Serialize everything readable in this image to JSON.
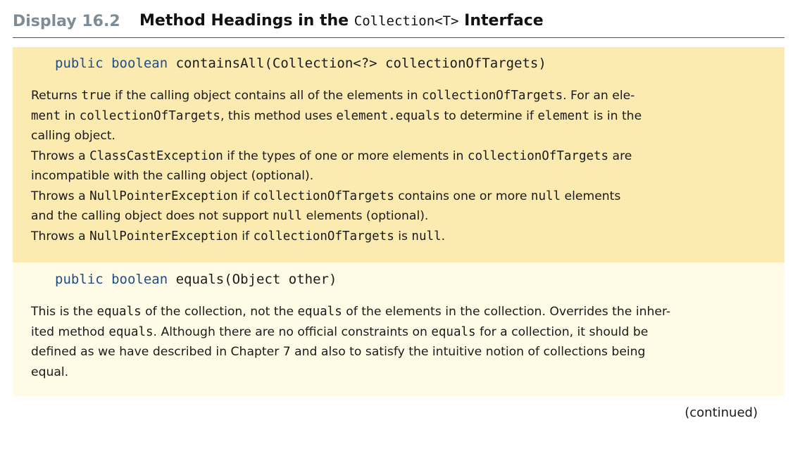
{
  "header": {
    "display_number": "Display 16.2",
    "title_prefix": "Method Headings in the ",
    "title_code": "Collection<T>",
    "title_suffix": " Interface"
  },
  "methods": [
    {
      "modifiers": "public boolean",
      "signature": "containsAll(Collection<?> collectionOfTargets)",
      "paragraphs": [
        {
          "runs": [
            {
              "text": "Returns ",
              "code": false
            },
            {
              "text": "true",
              "code": true
            },
            {
              "text": " if the calling object contains all of the elements in ",
              "code": false
            },
            {
              "text": "collectionOfTargets",
              "code": true
            },
            {
              "text": ". For an ele-",
              "code": false
            },
            {
              "text": "\n",
              "code": false
            },
            {
              "text": "ment",
              "code": true
            },
            {
              "text": " in ",
              "code": false
            },
            {
              "text": "collectionOfTargets",
              "code": true
            },
            {
              "text": ", this method uses ",
              "code": false
            },
            {
              "text": "element.equals",
              "code": true
            },
            {
              "text": " to determine if ",
              "code": false
            },
            {
              "text": "element",
              "code": true
            },
            {
              "text": " is in the",
              "code": false
            },
            {
              "text": "\n",
              "code": false
            },
            {
              "text": "calling object.",
              "code": false
            }
          ]
        },
        {
          "runs": [
            {
              "text": "Throws a ",
              "code": false
            },
            {
              "text": "ClassCastException",
              "code": true
            },
            {
              "text": " if the types of one or more elements in ",
              "code": false
            },
            {
              "text": "collectionOfTargets",
              "code": true
            },
            {
              "text": " are",
              "code": false
            },
            {
              "text": "\n",
              "code": false
            },
            {
              "text": "incompatible with the calling object (optional).",
              "code": false
            }
          ]
        },
        {
          "runs": [
            {
              "text": "Throws a ",
              "code": false
            },
            {
              "text": "NullPointerException",
              "code": true
            },
            {
              "text": " if ",
              "code": false
            },
            {
              "text": "collectionOfTargets",
              "code": true
            },
            {
              "text": " contains one or more ",
              "code": false
            },
            {
              "text": "null",
              "code": true
            },
            {
              "text": " elements",
              "code": false
            },
            {
              "text": "\n",
              "code": false
            },
            {
              "text": "and the calling object does not support ",
              "code": false
            },
            {
              "text": "null",
              "code": true
            },
            {
              "text": " elements (optional).",
              "code": false
            }
          ]
        },
        {
          "runs": [
            {
              "text": "Throws a ",
              "code": false
            },
            {
              "text": "NullPointerException",
              "code": true
            },
            {
              "text": " if ",
              "code": false
            },
            {
              "text": "collectionOfTargets",
              "code": true
            },
            {
              "text": " is ",
              "code": false
            },
            {
              "text": "null",
              "code": true
            },
            {
              "text": ".",
              "code": false
            }
          ]
        }
      ]
    },
    {
      "modifiers": "public boolean",
      "signature": "equals(Object other)",
      "paragraphs": [
        {
          "runs": [
            {
              "text": "This is the ",
              "code": false
            },
            {
              "text": "equals",
              "code": true
            },
            {
              "text": " of the collection, not the ",
              "code": false
            },
            {
              "text": "equals",
              "code": true
            },
            {
              "text": " of the elements in the collection. Overrides the inher-",
              "code": false
            },
            {
              "text": "\n",
              "code": false
            },
            {
              "text": "ited method ",
              "code": false
            },
            {
              "text": "equals",
              "code": true
            },
            {
              "text": ". Although there are no official constraints on ",
              "code": false
            },
            {
              "text": "equals",
              "code": true
            },
            {
              "text": " for a collection, it should be",
              "code": false
            },
            {
              "text": "\n",
              "code": false
            },
            {
              "text": "defined as we have described in Chapter 7 and also to satisfy the intuitive notion of collections being",
              "code": false
            },
            {
              "text": "\n",
              "code": false
            },
            {
              "text": "equal.",
              "code": false
            }
          ]
        }
      ]
    }
  ],
  "footer": {
    "continued": "(continued)"
  }
}
